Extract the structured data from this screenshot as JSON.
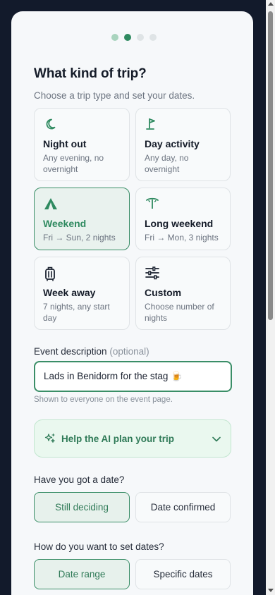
{
  "progress": {
    "steps": 4,
    "current_step": 2
  },
  "heading": "What kind of trip?",
  "subtitle": "Choose a trip type and set your dates.",
  "trip_types": [
    {
      "title": "Night out",
      "desc": "Any evening, no overnight",
      "icon": "moon-icon",
      "selected": false
    },
    {
      "title": "Day activity",
      "desc": "Any day, no overnight",
      "icon": "flag-icon",
      "selected": false
    },
    {
      "title": "Weekend",
      "desc": "Fri → Sun, 2 nights",
      "icon": "tent-icon",
      "selected": true
    },
    {
      "title": "Long weekend",
      "desc": "Fri → Mon, 3 nights",
      "icon": "umbrella-icon",
      "selected": false
    },
    {
      "title": "Week away",
      "desc": "7 nights, any start day",
      "icon": "suitcase-icon",
      "selected": false
    },
    {
      "title": "Custom",
      "desc": "Choose number of nights",
      "icon": "sliders-icon",
      "selected": false
    }
  ],
  "description": {
    "label": "Event description",
    "optional": "(optional)",
    "value": "Lads in Benidorm for the stag 🍺",
    "hint": "Shown to everyone on the event page."
  },
  "ai_panel": {
    "label": "Help the AI plan your trip"
  },
  "date_question": {
    "label": "Have you got a date?",
    "options": [
      "Still deciding",
      "Date confirmed"
    ],
    "selected": "Still deciding"
  },
  "date_mode": {
    "label": "How do you want to set dates?",
    "options": [
      "Date range",
      "Specific dates"
    ],
    "selected": "Date range"
  },
  "colors": {
    "accent": "#2f8a60",
    "background": "#121a2b",
    "card": "#f6f8fa"
  }
}
